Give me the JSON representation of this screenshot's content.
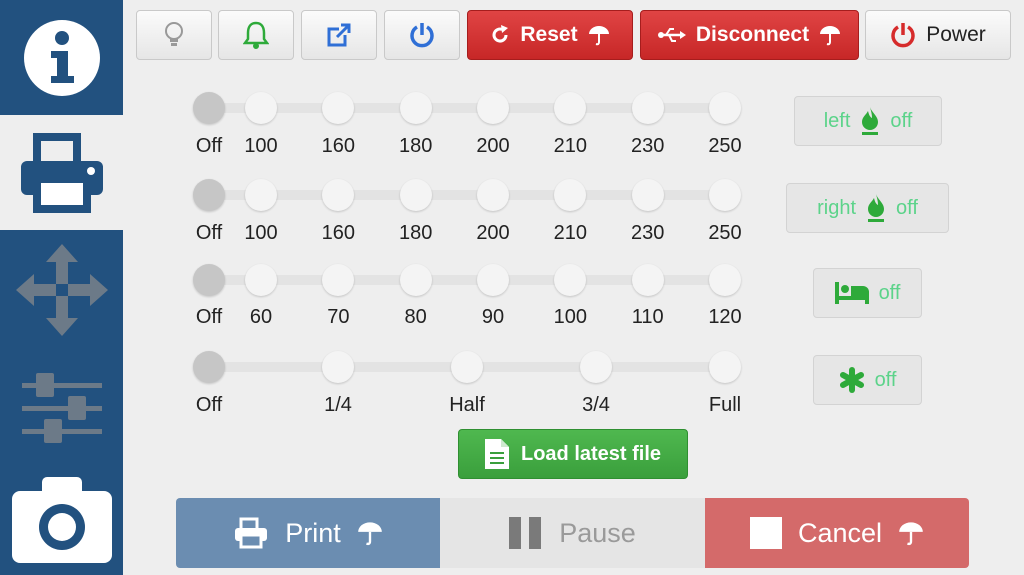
{
  "sidebar": {
    "tabs": [
      {
        "name": "info-icon",
        "active": false
      },
      {
        "name": "printer-icon",
        "active": true
      },
      {
        "name": "move-arrows-icon",
        "active": false
      },
      {
        "name": "sliders-icon",
        "active": false
      },
      {
        "name": "camera-icon",
        "active": false
      }
    ]
  },
  "toolbar": {
    "light_icon": "lightbulb-icon",
    "bell_icon": "bell-icon",
    "external_icon": "external-link-icon",
    "power_icon": "power-icon",
    "reset_label": "Reset",
    "disconnect_label": "Disconnect",
    "power_label": "Power"
  },
  "sliders": [
    {
      "name": "left-extruder-temp",
      "ticks": [
        "Off",
        "100",
        "160",
        "180",
        "200",
        "210",
        "230",
        "250"
      ],
      "selected": 0
    },
    {
      "name": "right-extruder-temp",
      "ticks": [
        "Off",
        "100",
        "160",
        "180",
        "200",
        "210",
        "230",
        "250"
      ],
      "selected": 0
    },
    {
      "name": "bed-temp",
      "ticks": [
        "Off",
        "60",
        "70",
        "80",
        "90",
        "100",
        "110",
        "120"
      ],
      "selected": 0
    },
    {
      "name": "fan-speed",
      "ticks": [
        "Off",
        "1/4",
        "Half",
        "3/4",
        "Full"
      ],
      "selected": 0
    }
  ],
  "toggles": {
    "left": {
      "label": "left",
      "state": "off"
    },
    "right": {
      "label": "right",
      "state": "off"
    },
    "bed": {
      "state": "off"
    },
    "fan": {
      "state": "off"
    }
  },
  "load_button": {
    "label": "Load latest file"
  },
  "bottom": {
    "print_label": "Print",
    "pause_label": "Pause",
    "cancel_label": "Cancel"
  },
  "colors": {
    "sidebar": "#22517f",
    "danger": "#c72727",
    "success": "#3a9f3c",
    "print": "#6b8db1",
    "cancel": "#d46a6a",
    "toggle_text": "#5cd38a"
  }
}
